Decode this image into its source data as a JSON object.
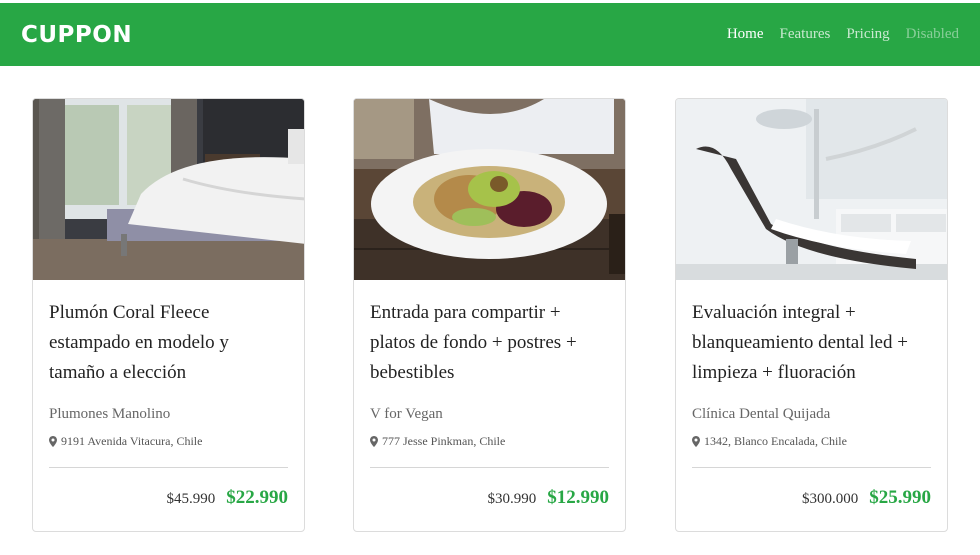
{
  "brand": "CUPPON",
  "nav": [
    {
      "label": "Home",
      "state": "active"
    },
    {
      "label": "Features",
      "state": "normal"
    },
    {
      "label": "Pricing",
      "state": "normal"
    },
    {
      "label": "Disabled",
      "state": "disabled"
    }
  ],
  "colors": {
    "accent": "#28a745"
  },
  "cards": [
    {
      "image": "bedroom-bed-photo",
      "title": "Plumón Coral Fleece estampado en modelo y tamaño a elección",
      "shop": "Plumones Manolino",
      "address": "9191 Avenida Vitacura, Chile",
      "old_price": "$45.990",
      "new_price": "$22.990"
    },
    {
      "image": "salad-plate-photo",
      "title": "Entrada para compartir + platos de fondo + postres + bebestibles",
      "shop": "V for Vegan",
      "address": "777 Jesse Pinkman, Chile",
      "old_price": "$30.990",
      "new_price": "$12.990"
    },
    {
      "image": "dental-chair-photo",
      "title": "Evaluación integral + blanqueamiento dental led + limpieza + fluoración",
      "shop": "Clínica Dental Quijada",
      "address": "1342, Blanco Encalada, Chile",
      "old_price": "$300.000",
      "new_price": "$25.990"
    }
  ]
}
